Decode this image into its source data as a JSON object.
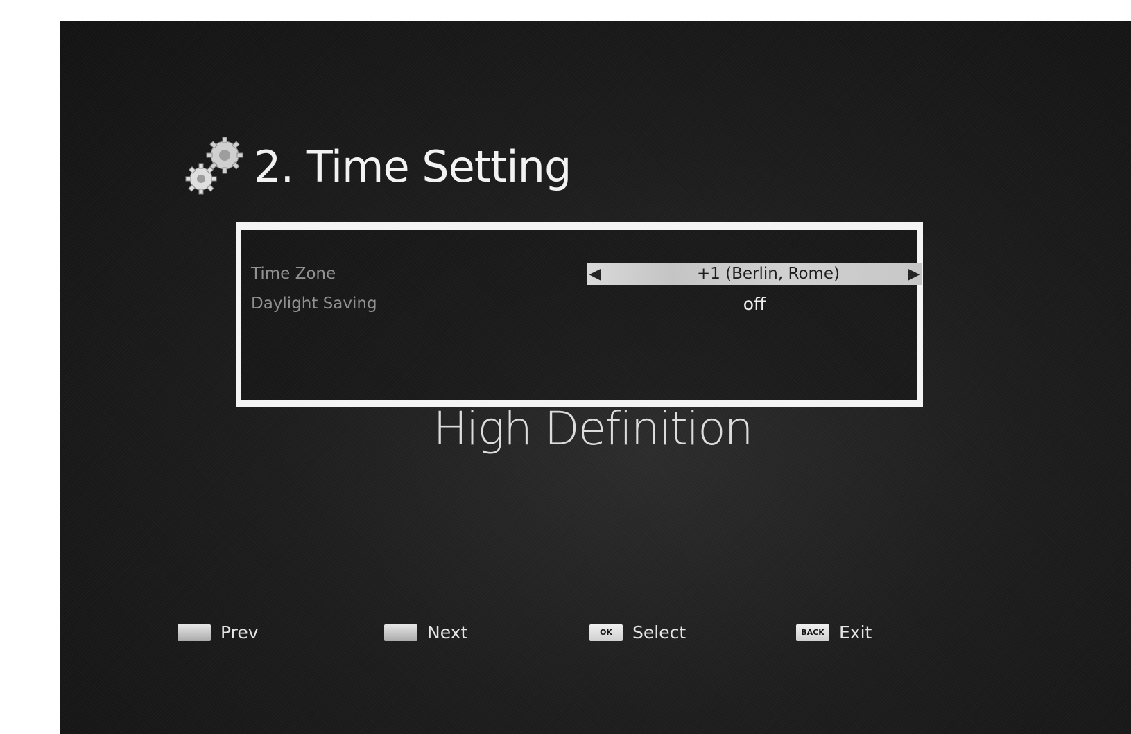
{
  "header": {
    "title": "2. Time Setting",
    "icon": "gears-icon"
  },
  "settings": {
    "rows": [
      {
        "label": "Time Zone",
        "value": "+1 (Berlin, Rome)"
      },
      {
        "label": "Daylight Saving",
        "value": "off"
      }
    ]
  },
  "brand": {
    "text": "High Definition"
  },
  "footer": {
    "items": [
      {
        "key": "",
        "label": "Prev"
      },
      {
        "key": "",
        "label": "Next"
      },
      {
        "key": "OK",
        "label": "Select"
      },
      {
        "key": "BACK",
        "label": "Exit"
      }
    ]
  },
  "colors": {
    "background": "#1c1c1c",
    "panel_border": "#f4f4f4",
    "selector": "#d0d0d0",
    "text": "#f2f2f2"
  }
}
